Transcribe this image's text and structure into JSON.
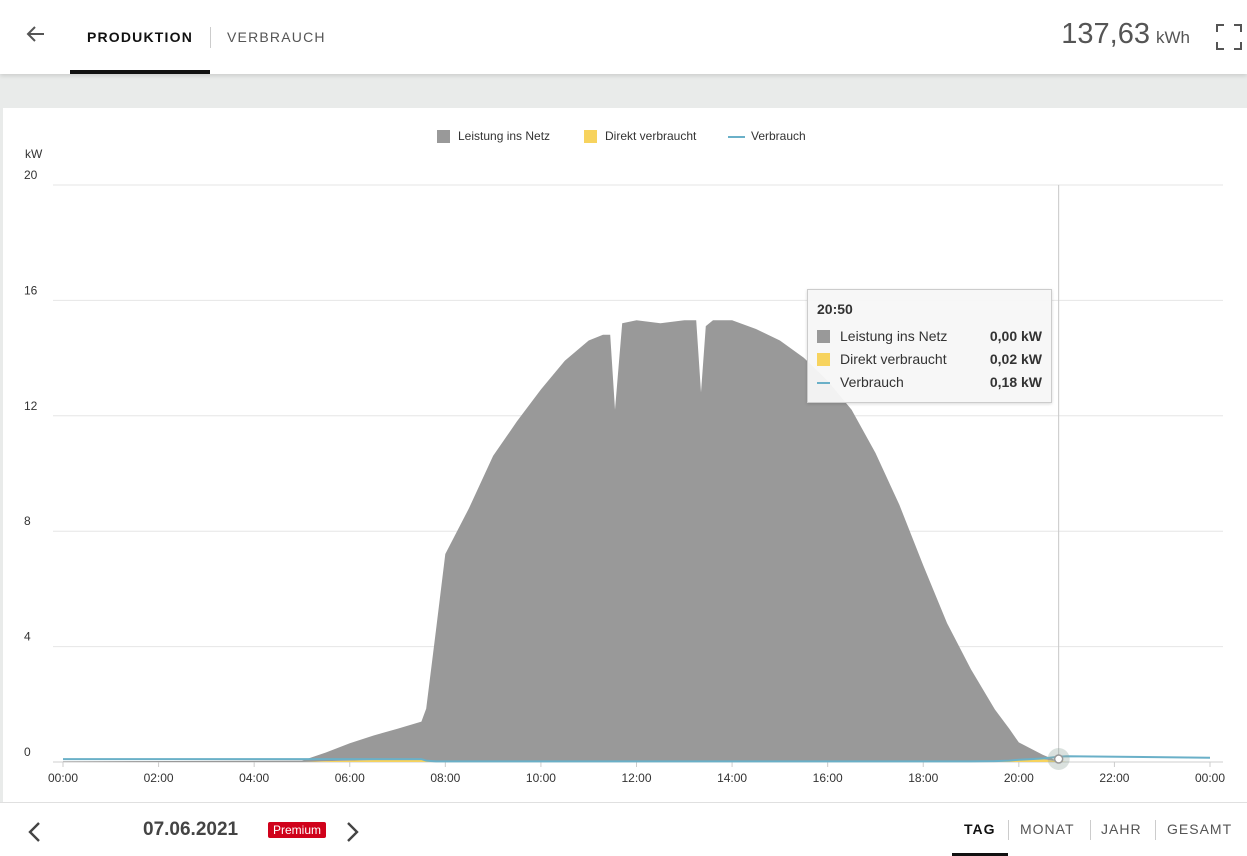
{
  "header": {
    "tab_production": "PRODUKTION",
    "tab_consumption": "VERBRAUCH",
    "total_value": "137,63",
    "total_unit": "kWh",
    "back_icon": "arrow-left-icon",
    "fullscreen_icon": "fullscreen-icon"
  },
  "legend": {
    "items": [
      {
        "label": "Leistung ins Netz",
        "color": "#999999"
      },
      {
        "label": "Direkt verbraucht",
        "color": "#f7d35e"
      },
      {
        "label": "Verbrauch",
        "color": "#6ab0c8"
      }
    ]
  },
  "tooltip": {
    "time": "20:50",
    "rows": [
      {
        "name": "Leistung ins Netz",
        "value": "0,00 kW"
      },
      {
        "name": "Direkt verbraucht",
        "value": "0,02 kW"
      },
      {
        "name": "Verbrauch",
        "value": "0,18 kW"
      }
    ]
  },
  "chart_data": {
    "type": "area",
    "ylabel": "kW",
    "ylim": [
      0,
      20
    ],
    "yticks": [
      "0",
      "4",
      "8",
      "12",
      "16",
      "20"
    ],
    "xticks": [
      "00:00",
      "02:00",
      "04:00",
      "06:00",
      "08:00",
      "10:00",
      "12:00",
      "14:00",
      "16:00",
      "18:00",
      "20:00",
      "22:00",
      "00:00"
    ],
    "x_hours": [
      0,
      5,
      5.5,
      6,
      6.5,
      7,
      7.5,
      7.6,
      7.8,
      8,
      8.5,
      9,
      9.5,
      10,
      10.5,
      11,
      11.3,
      11.45,
      11.55,
      11.7,
      12,
      12.5,
      13,
      13.25,
      13.35,
      13.45,
      13.6,
      14,
      14.5,
      15,
      15.5,
      16,
      16.5,
      17,
      17.5,
      18,
      18.5,
      19,
      19.5,
      19.8,
      20,
      20.5,
      20.83,
      21,
      24
    ],
    "series": [
      {
        "name": "Leistung ins Netz",
        "values": [
          0.02,
          0.05,
          0.3,
          0.6,
          0.85,
          1.05,
          1.3,
          1.8,
          4.5,
          7.2,
          8.8,
          10.6,
          11.8,
          12.9,
          13.9,
          14.6,
          14.8,
          14.8,
          12.2,
          15.2,
          15.3,
          15.2,
          15.3,
          15.3,
          12.8,
          15.1,
          15.3,
          15.3,
          15.0,
          14.6,
          14.0,
          13.2,
          12.2,
          10.7,
          8.9,
          6.8,
          4.8,
          3.2,
          1.8,
          1.1,
          0.6,
          0.15,
          0.0,
          0.0,
          0.0
        ]
      },
      {
        "name": "Direkt verbraucht",
        "values": [
          0.0,
          0.0,
          0.03,
          0.05,
          0.07,
          0.1,
          0.1,
          0.05,
          0.02,
          0.01,
          0.01,
          0.01,
          0.01,
          0.01,
          0.01,
          0.01,
          0.01,
          0.01,
          0.01,
          0.01,
          0.01,
          0.01,
          0.01,
          0.01,
          0.01,
          0.01,
          0.01,
          0.01,
          0.01,
          0.01,
          0.01,
          0.01,
          0.01,
          0.01,
          0.01,
          0.01,
          0.01,
          0.01,
          0.02,
          0.05,
          0.08,
          0.1,
          0.02,
          0.0,
          0.0
        ]
      },
      {
        "name": "Verbrauch",
        "values": [
          0.1,
          0.1,
          0.1,
          0.1,
          0.1,
          0.1,
          0.1,
          0.05,
          0.02,
          0.02,
          0.02,
          0.02,
          0.02,
          0.02,
          0.02,
          0.02,
          0.02,
          0.02,
          0.02,
          0.02,
          0.02,
          0.02,
          0.02,
          0.02,
          0.02,
          0.02,
          0.02,
          0.02,
          0.02,
          0.02,
          0.02,
          0.02,
          0.02,
          0.02,
          0.02,
          0.02,
          0.02,
          0.02,
          0.03,
          0.05,
          0.08,
          0.12,
          0.18,
          0.2,
          0.15
        ]
      }
    ],
    "grid": true,
    "legend_position": "top-center",
    "highlighted_time": "20:50"
  },
  "footer": {
    "date": "07.06.2021",
    "badge": "Premium",
    "periods": [
      "TAG",
      "MONAT",
      "JAHR",
      "GESAMT"
    ],
    "active_period": "TAG"
  }
}
